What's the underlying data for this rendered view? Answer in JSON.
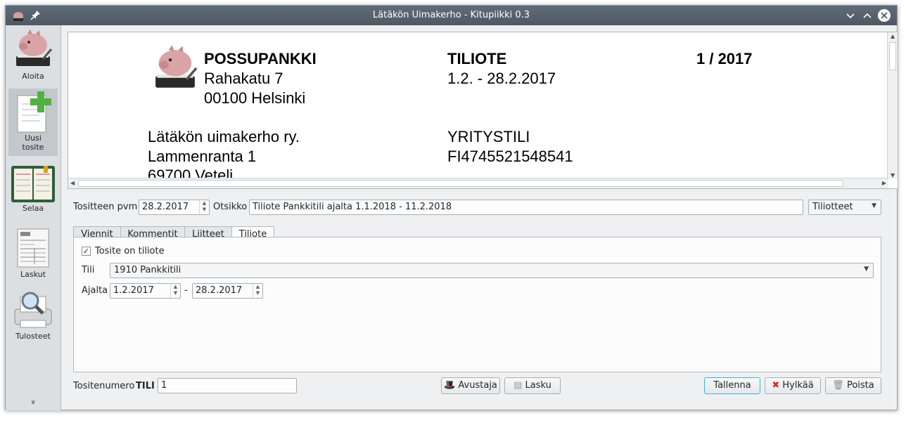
{
  "window": {
    "title": "Lätäkön Uimakerho - Kitupiikki 0.3"
  },
  "sidebar": {
    "items": [
      {
        "label": "Aloita",
        "icon": "piggy-bank-icon"
      },
      {
        "label": "Uusi\ntosite",
        "icon": "new-document-icon"
      },
      {
        "label": "Selaa",
        "icon": "ledger-book-icon"
      },
      {
        "label": "Laskut",
        "icon": "invoice-icon"
      },
      {
        "label": "Tulosteet",
        "icon": "print-preview-icon"
      }
    ],
    "more": "»"
  },
  "preview": {
    "bank_name": "POSSUPANKKI",
    "bank_street": "Rahakatu 7",
    "bank_city": "00100 Helsinki",
    "doc_title": "TILIOTE",
    "doc_period": "1.2. - 28.2.2017",
    "doc_number": "1 / 2017",
    "customer_name": "Lätäkön uimakerho ry.",
    "customer_street": "Lammenranta 1",
    "customer_city": "69700 Veteli",
    "account_type": "YRITYSTILI",
    "account_iban": "FI4745521548541"
  },
  "form": {
    "date_label": "Tositteen pvm",
    "date_value": "28.2.2017",
    "title_label": "Otsikko",
    "title_value": "Tiliote Pankkitili ajalta 1.1.2018 - 11.2.2018",
    "type_value": "Tiliotteet"
  },
  "tabs": [
    {
      "label": "Viennit",
      "active": false
    },
    {
      "label": "Kommentit",
      "active": false
    },
    {
      "label": "Liitteet",
      "active": false
    },
    {
      "label": "Tiliote",
      "active": true
    }
  ],
  "tiliote": {
    "checkbox_label": "Tosite on tiliote",
    "checked": true,
    "check_mark": "✓",
    "account_label": "Tili",
    "account_value": "1910 Pankkitili",
    "period_label": "Ajalta",
    "period_from": "1.2.2017",
    "period_sep": "-",
    "period_to": "28.2.2017"
  },
  "footer": {
    "number_label": "Tositenumero",
    "series": "TILI",
    "number_value": "1",
    "assistant_button": "Avustaja",
    "invoice_button": "Lasku",
    "save_button": "Tallenna",
    "reject_button": "Hylkää",
    "delete_button": "Poista"
  },
  "colors": {
    "titlebar": "#4f5964",
    "window_bg": "#eff0f1",
    "focus_accent": "#3daee9",
    "reject_icon": "#d62d20"
  }
}
